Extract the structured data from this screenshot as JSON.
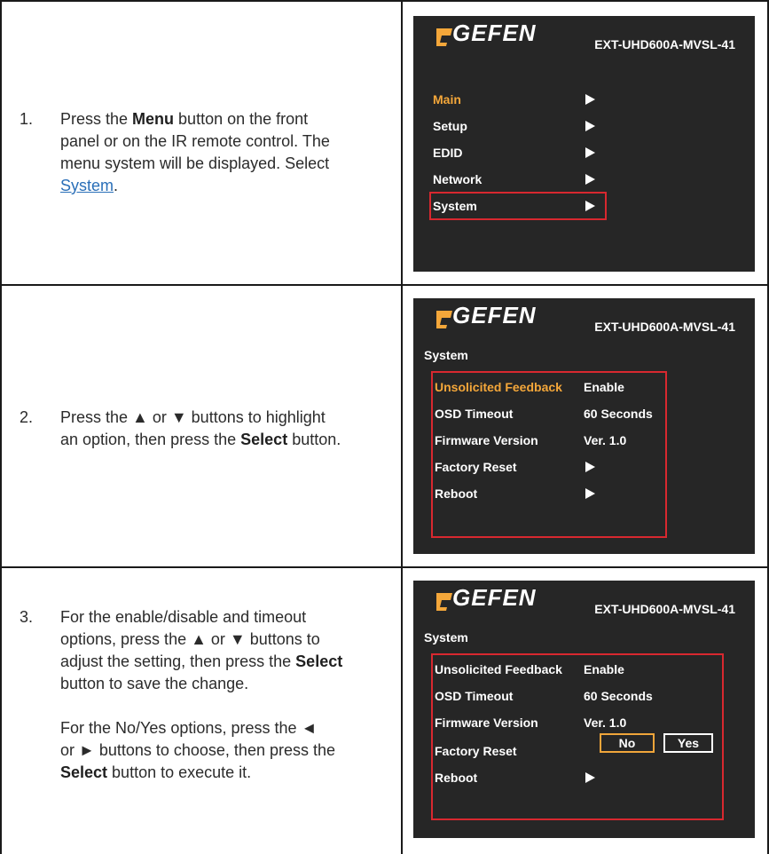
{
  "steps": [
    {
      "number": "1.",
      "lines": [
        [
          "Press the ",
          "Menu",
          " button on the front"
        ],
        [
          "panel or on the IR remote control. The"
        ],
        [
          "menu system will be displayed. Select"
        ],
        [
          "System",
          "."
        ]
      ],
      "screen": {
        "brand": "GEFEN",
        "model": "EXT-UHD600A-MVSL-41",
        "menu": [
          "Main",
          "Setup",
          "EDID",
          "Network",
          "System"
        ]
      }
    },
    {
      "number": "2.",
      "line1": "Press the ▲ or ▼ buttons to highlight",
      "line2_pre": "an option, then press the ",
      "line2_bold": "Select",
      "line2_post": " button.",
      "screen": {
        "brand": "GEFEN",
        "model": "EXT-UHD600A-MVSL-41",
        "title": "System",
        "rows": [
          {
            "label": "Unsolicited Feedback",
            "value": "Enable"
          },
          {
            "label": "OSD Timeout",
            "value": "60 Seconds"
          },
          {
            "label": "Firmware Version",
            "value": "Ver. 1.0"
          },
          {
            "label": "Factory Reset",
            "value": ""
          },
          {
            "label": "Reboot",
            "value": ""
          }
        ]
      }
    },
    {
      "number": "3.",
      "p1_l1": "For the enable/disable and timeout",
      "p1_l2": "options, press the ▲ or ▼ buttons to",
      "p1_l3_pre": "adjust the setting, then press the ",
      "p1_l3_bold": "Select",
      "p1_l4": "button to save the change.",
      "p2_l1": "For the No/Yes options, press the ◄",
      "p2_l2": "or ► buttons to choose, then press the",
      "p2_l3_bold": "Select",
      "p2_l3_post": " button to execute it.",
      "screen": {
        "brand": "GEFEN",
        "model": "EXT-UHD600A-MVSL-41",
        "title": "System",
        "rows": [
          {
            "label": "Unsolicited Feedback",
            "value": "Enable"
          },
          {
            "label": "OSD Timeout",
            "value": "60 Seconds"
          },
          {
            "label": "Firmware Version",
            "value": "Ver. 1.0"
          },
          {
            "label": "Factory Reset",
            "value": ""
          },
          {
            "label": "Reboot",
            "value": ""
          }
        ],
        "no_label": "No",
        "yes_label": "Yes"
      }
    }
  ],
  "colors": {
    "screen_bg": "#262626",
    "highlight": "#f4a73a",
    "red_frame": "#d8282f",
    "link": "#2a6fb8"
  }
}
